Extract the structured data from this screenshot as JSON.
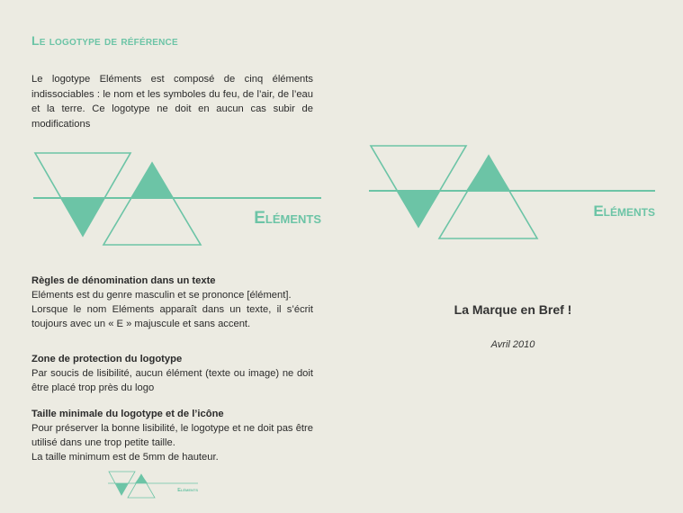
{
  "title": "Le logotype de référence",
  "intro": "Le logotype Eléments est composé de cinq éléments indissociables : le nom et les symboles du feu, de l’air, de l’eau et la terre. Ce logotype ne doit en aucun cas subir de modifications",
  "logo_wordmark": "Eléments",
  "colors": {
    "accent": "#6cc4a6",
    "background": "#ecebe2",
    "text": "#2b2b2b"
  },
  "sections": [
    {
      "heading": "Règles de dénomination dans un texte",
      "lines": [
        "Eléments est du genre masculin et se prononce [élément].",
        "Lorsque le nom Eléments apparaît dans un texte, il s’écrit toujours avec un « E » majuscule et sans accent."
      ]
    },
    {
      "heading": "Zone de protection du logotype",
      "lines": [
        "Par soucis de lisibilité, aucun élément (texte ou image) ne doit être placé trop près du logo"
      ]
    },
    {
      "heading": "Taille minimale du logotype et de l’icône",
      "lines": [
        "Pour préserver la bonne lisibilité, le logotype et ne doit pas être utilisé dans une trop petite taille.",
        "La taille minimum est de 5mm de hauteur."
      ]
    }
  ],
  "tagline": "La Marque en Bref !",
  "date": "Avril 2010"
}
